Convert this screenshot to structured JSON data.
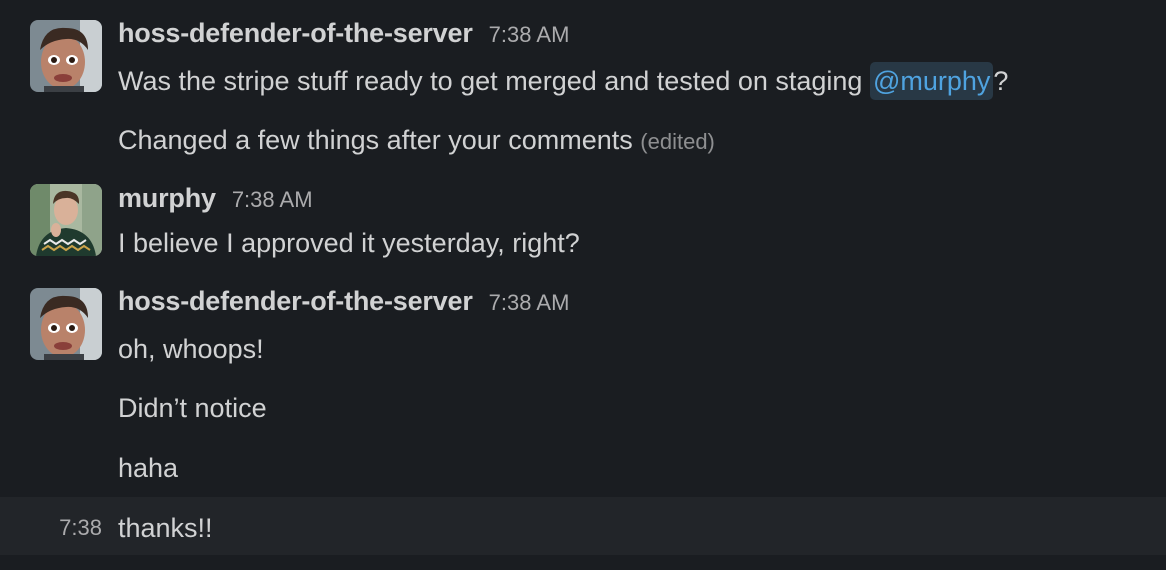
{
  "messages": [
    {
      "author": "hoss-defender-of-the-server",
      "time": "7:38 AM",
      "lines": {
        "l1_prefix": "Was the stripe stuff ready to get merged and tested on staging ",
        "l1_mention": "@murphy",
        "l1_suffix": "?",
        "l2_text": "Changed a few things after your comments ",
        "l2_edited": "(edited)"
      }
    },
    {
      "author": "murphy",
      "time": "7:38 AM",
      "lines": {
        "l1": "I believe I approved it yesterday, right?"
      }
    },
    {
      "author": "hoss-defender-of-the-server",
      "time": "7:38 AM",
      "lines": {
        "l1": "oh, whoops!",
        "l2": "Didn’t notice",
        "l3": "haha"
      }
    }
  ],
  "hover_message": {
    "time": "7:38",
    "text": "thanks!!"
  },
  "colors": {
    "background": "#1a1d21",
    "hover_background": "#222529",
    "mention_text": "#4fa3e0",
    "mention_background": "#283845"
  }
}
